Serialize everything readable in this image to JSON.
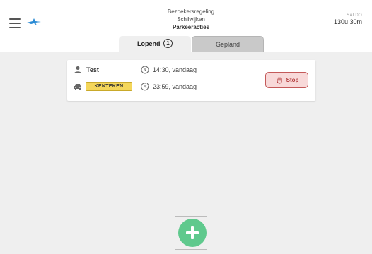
{
  "header": {
    "title_line1": "Bezoekersregeling",
    "title_line2": "Schilwijken",
    "title_line3": "Parkeeracties",
    "saldo_label": "SALDO",
    "saldo_value": "130u 30m",
    "icons": [
      "menu-icon",
      "logo-icon"
    ]
  },
  "tabs": [
    {
      "label": "Lopend",
      "count": "1",
      "active": true
    },
    {
      "label": "Gepland",
      "active": false
    }
  ],
  "session": {
    "name": "Test",
    "plate": "KENTEKEN",
    "start_time": "14:30, vandaag",
    "end_time": "23:59, vandaag",
    "stop_label": "Stop",
    "icons": [
      "person-icon",
      "car-icon",
      "clock-icon",
      "clock-end-icon",
      "hand-icon"
    ]
  },
  "fab": {
    "icon": "plus-icon"
  },
  "colors": {
    "plate_bg": "#f4d65a",
    "stop_border": "#c45a5a",
    "stop_bg": "#f8d9d9",
    "fab": "#5fc98d",
    "logo": "#2a8ad4"
  }
}
